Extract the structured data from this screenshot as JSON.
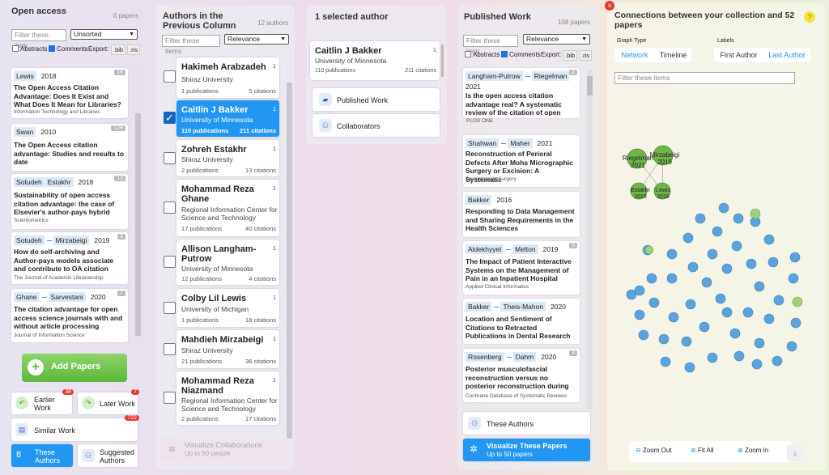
{
  "col1": {
    "title": "Open access",
    "count": "6 papers",
    "filter_placeholder": "Filter these item",
    "sort": "Unsorted",
    "abstracts": "Abstracts",
    "comments": "Comments",
    "export": "Export:",
    "bib": ".bib",
    "ris": ".ris",
    "papers": [
      {
        "authors": [
          "Lewis"
        ],
        "year": "2018",
        "badge": "18",
        "title": "The Open Access Citation Advantage: Does It Exist and What Does It Mean for Libraries?",
        "source": "Information Technology and Libraries"
      },
      {
        "authors": [
          "Swan"
        ],
        "year": "2010",
        "badge": "129",
        "title": "The Open Access citation advantage: Studies and results to date",
        "source": ""
      },
      {
        "authors": [
          "Sotudeh",
          "Estakhr"
        ],
        "year": "2018",
        "badge": "13",
        "title": "Sustainability of open access citation advantage: the case of Elsevier's author-pays hybrid",
        "source": "Scientometrics"
      },
      {
        "authors": [
          "Sotudeh",
          "Mirzabeigi"
        ],
        "year": "2019",
        "badge": "5",
        "title": "How do self-archiving and Author-pays models associate and contribute to OA citation",
        "source": "The Journal of Academic Librarianship"
      },
      {
        "authors": [
          "Ghane",
          "Sarvestani"
        ],
        "year": "2020",
        "badge": "7",
        "title": "The citation advantage for open access science journals with and without article processing",
        "source": "Journal of Information Science"
      }
    ],
    "add_papers": "Add Papers",
    "earlier_work": "Earlier Work",
    "earlier_count": "38",
    "later_work": "Later Work",
    "later_count": "7",
    "similar_work": "Similar Work",
    "similar_count": "722",
    "these_authors": "These Authors",
    "suggested_authors": "Suggested Authors"
  },
  "col2": {
    "title": "Authors in the Previous Column",
    "count": "12 authors",
    "filter_placeholder": "Filter these items",
    "sort": "Relevance",
    "authors": [
      {
        "name": "Hakimeh Arabzadeh",
        "aff": "Shiraz University",
        "pubs": "1 publications",
        "cites": "5 citations",
        "n": "1"
      },
      {
        "name": "Caitlin J Bakker",
        "aff": "University of Minnesota",
        "pubs": "110 publications",
        "cites": "211 citations",
        "n": "1"
      },
      {
        "name": "Zohreh Estakhr",
        "aff": "Shiraz University",
        "pubs": "2 publications",
        "cites": "13 citations",
        "n": "1"
      },
      {
        "name": "Mohammad Reza Ghane",
        "aff": "Regional Information Center for Science and Technology",
        "pubs": "17 publications",
        "cites": "40 citations",
        "n": "1"
      },
      {
        "name": "Allison Langham-Putrow",
        "aff": "University of Minnesota",
        "pubs": "12 publications",
        "cites": "4 citations",
        "n": "1"
      },
      {
        "name": "Colby Lil Lewis",
        "aff": "University of Michigan",
        "pubs": "1 publications",
        "cites": "18 citations",
        "n": "1"
      },
      {
        "name": "Mahdieh Mirzabeigi",
        "aff": "Shiraz University",
        "pubs": "21 publications",
        "cites": "36 citations",
        "n": "1"
      },
      {
        "name": "Mohammad Reza Niazmand",
        "aff": "Regional Information Center for Science and Technology",
        "pubs": "2 publications",
        "cites": "17 citations",
        "n": "1"
      }
    ],
    "visualize": "Visualize Collaborations",
    "visualize_sub": "Up to 50 people"
  },
  "col3": {
    "title": "1 selected author",
    "name": "Caitlin J Bakker",
    "aff": "University of Minnesota",
    "pubs": "110 publications",
    "cites": "211 citations",
    "n": "1",
    "published_work": "Published Work",
    "collaborators": "Collaborators"
  },
  "col4": {
    "title": "Published Work",
    "count": "108 papers",
    "filter_placeholder": "Filter these item",
    "sort": "Relevance",
    "abstracts": "Abstracts",
    "comments": "Comments",
    "export": "Export:",
    "bib": ".bib",
    "ris": ".ris",
    "papers": [
      {
        "authors": [
          "Langham-Putrow",
          "Riegelman"
        ],
        "year": "2021",
        "badge": "2",
        "title": "Is the open access citation advantage real? A systematic review of the citation of open",
        "source": "PLOS ONE"
      },
      {
        "authors": [
          "Shahwan",
          "Maher"
        ],
        "year": "2021",
        "badge": "",
        "title": "Reconstruction of Perioral Defects After Mohs Micrographic Surgery or Excision: A Systematic",
        "source": "Dermatologic Surgery"
      },
      {
        "authors": [
          "Bakker"
        ],
        "year": "2016",
        "badge": "",
        "title": "Responding to Data Management and Sharing Requirements in the Health Sciences",
        "source": ""
      },
      {
        "authors": [
          "Aldekhyyel",
          "Melton"
        ],
        "year": "2019",
        "badge": "3",
        "title": "The Impact of Patient Interactive Systems on the Management of Pain in an Inpatient Hospital",
        "source": "Applied Clinical Informatics"
      },
      {
        "authors": [
          "Bakker",
          "Theis-Mahon"
        ],
        "year": "2020",
        "badge": "",
        "title": "Location and Sentiment of Citations to Retracted Publications in Dental Research",
        "source": ""
      },
      {
        "authors": [
          "Rosenberg",
          "Dahm"
        ],
        "year": "2020",
        "badge": "3",
        "title": "Posterior musculofascial reconstruction versus no posterior reconstruction during",
        "source": "Cochrane Database of Systematic Reviews"
      }
    ],
    "these_authors": "These Authors",
    "visualize": "Visualize These Papers",
    "visualize_sub": "Up to 50 papers"
  },
  "graph": {
    "title": "Connections between your collection and 52 papers",
    "graph_type": "Graph Type",
    "network": "Network",
    "timeline": "Timeline",
    "labels": "Labels",
    "first_author": "First Author",
    "last_author": "Last Author",
    "filter_placeholder": "Filter these items",
    "zoom_out": "Zoom Out",
    "fit_all": "Fit All",
    "zoom_in": "Zoom In",
    "big_nodes": [
      {
        "label": "Riegelman 2021"
      },
      {
        "label": "Mirzabeigi 2019"
      },
      {
        "label": "Estakhr 2018"
      },
      {
        "label": "Lewis 2018"
      }
    ]
  },
  "colors": {
    "accent": "#2196f3",
    "green": "#6fbf4a",
    "node_blue": "#5aa3dc"
  }
}
